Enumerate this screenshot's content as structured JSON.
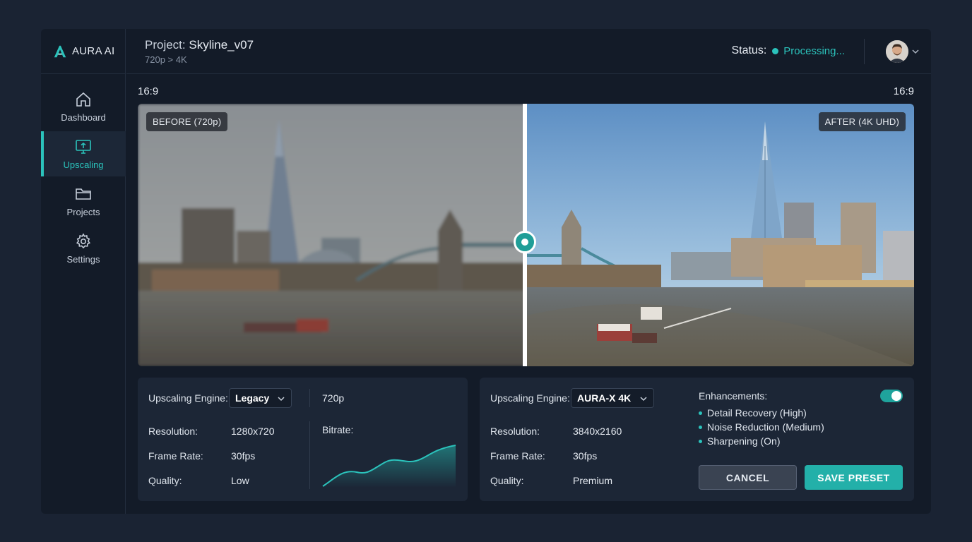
{
  "app": {
    "name": "AURA AI"
  },
  "sidebar": {
    "items": [
      {
        "label": "Dashboard",
        "icon": "home-icon",
        "active": false
      },
      {
        "label": "Upscaling",
        "icon": "upscale-monitor-icon",
        "active": true
      },
      {
        "label": "Projects",
        "icon": "folder-icon",
        "active": false
      },
      {
        "label": "Settings",
        "icon": "gear-icon",
        "active": false
      }
    ]
  },
  "header": {
    "project_label": "Project:",
    "project_name": "Skyline_v07",
    "subtitle": "720p > 4K",
    "status_label": "Status:",
    "status_value": "Processing..."
  },
  "viewer": {
    "aspect_left": "16:9",
    "aspect_right": "16:9",
    "before_label": "BEFORE (720p)",
    "after_label": "AFTER (4K UHD)"
  },
  "left_panel": {
    "engine_label": "Upscaling Engine:",
    "engine_value": "Legacy",
    "res_tag": "720p",
    "resolution_label": "Resolution:",
    "resolution_value": "1280x720",
    "framerate_label": "Frame Rate:",
    "framerate_value": "30fps",
    "quality_label": "Quality:",
    "quality_value": "Low",
    "bitrate_label": "Bitrate:"
  },
  "right_panel": {
    "engine_label": "Upscaling Engine:",
    "engine_value": "AURA-X 4K",
    "resolution_label": "Resolution:",
    "resolution_value": "3840x2160",
    "framerate_label": "Frame Rate:",
    "framerate_value": "30fps",
    "quality_label": "Quality:",
    "quality_value": "Premium",
    "enhancements_label": "Enhancements:",
    "enhancements_on": true,
    "enhancements": [
      "Detail Recovery (High)",
      "Noise Reduction (Medium)",
      "Sharpening (On)"
    ],
    "cancel_label": "CANCEL",
    "save_label": "SAVE PRESET"
  },
  "colors": {
    "accent": "#2bc3bc",
    "panel": "#1c2636",
    "background": "#131b28"
  }
}
